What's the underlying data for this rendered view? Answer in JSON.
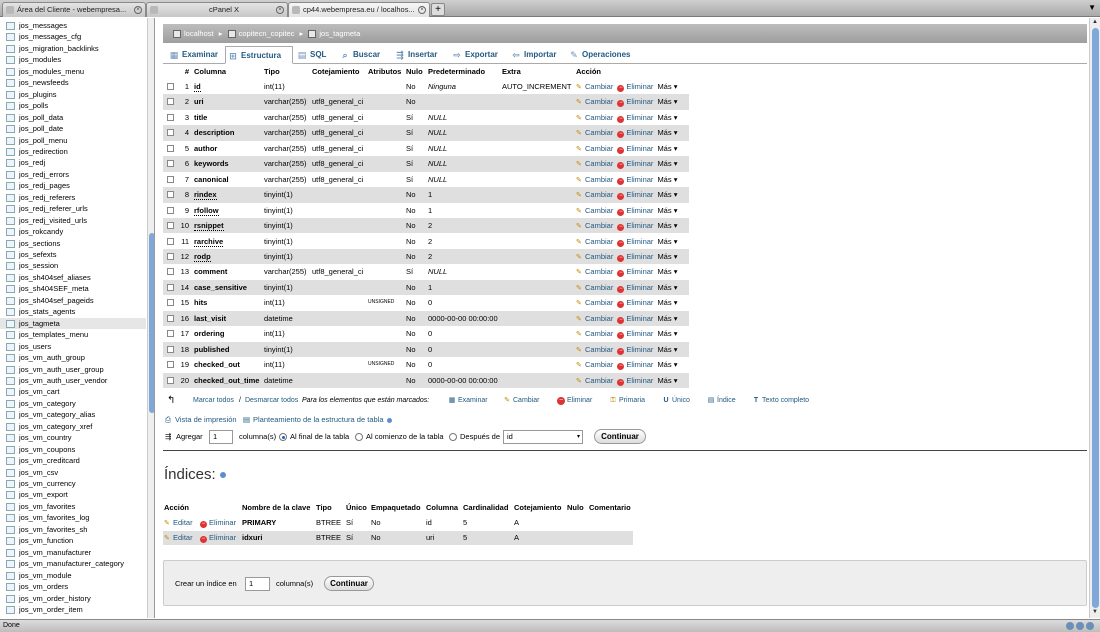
{
  "browser": {
    "tabs": [
      {
        "label": "Área del Cliente - webempresa...",
        "active": false
      },
      {
        "label": "cPanel X",
        "active": false
      },
      {
        "label": "cp44.webempresa.eu / localhos...",
        "active": true
      }
    ],
    "new_tab": "+",
    "status": "Done"
  },
  "left_tables": [
    "jos_messages",
    "jos_messages_cfg",
    "jos_migration_backlinks",
    "jos_modules",
    "jos_modules_menu",
    "jos_newsfeeds",
    "jos_plugins",
    "jos_polls",
    "jos_poll_data",
    "jos_poll_date",
    "jos_poll_menu",
    "jos_redirection",
    "jos_redj",
    "jos_redj_errors",
    "jos_redj_pages",
    "jos_redj_referers",
    "jos_redj_referer_urls",
    "jos_redj_visited_urls",
    "jos_rokcandy",
    "jos_sections",
    "jos_sefexts",
    "jos_session",
    "jos_sh404sef_aliases",
    "jos_sh404SEF_meta",
    "jos_sh404sef_pageids",
    "jos_stats_agents",
    "jos_tagmeta",
    "jos_templates_menu",
    "jos_users",
    "jos_vm_auth_group",
    "jos_vm_auth_user_group",
    "jos_vm_auth_user_vendor",
    "jos_vm_cart",
    "jos_vm_category",
    "jos_vm_category_alias",
    "jos_vm_category_xref",
    "jos_vm_country",
    "jos_vm_coupons",
    "jos_vm_creditcard",
    "jos_vm_csv",
    "jos_vm_currency",
    "jos_vm_export",
    "jos_vm_favorites",
    "jos_vm_favorites_log",
    "jos_vm_favorites_sh",
    "jos_vm_function",
    "jos_vm_manufacturer",
    "jos_vm_manufacturer_category",
    "jos_vm_module",
    "jos_vm_orders",
    "jos_vm_order_history",
    "jos_vm_order_item"
  ],
  "current_table_index": 26,
  "breadcrumb": {
    "server": "localhost",
    "database": "copitecn_copitec",
    "table": "jos_tagmeta",
    "sep": "▸"
  },
  "tabs": [
    {
      "label": "Examinar",
      "icon": "▦"
    },
    {
      "label": "Estructura",
      "icon": "⊞",
      "active": true
    },
    {
      "label": "SQL",
      "icon": "▤"
    },
    {
      "label": "Buscar",
      "icon": "⌕"
    },
    {
      "label": "Insertar",
      "icon": "⇶"
    },
    {
      "label": "Exportar",
      "icon": "⇨"
    },
    {
      "label": "Importar",
      "icon": "⇦"
    },
    {
      "label": "Operaciones",
      "icon": "✎"
    }
  ],
  "structure": {
    "headers": {
      "num": "#",
      "col": "Columna",
      "typ": "Tipo",
      "cot": "Cotejamiento",
      "atr": "Atributos",
      "nul": "Nulo",
      "pre": "Predeterminado",
      "ext": "Extra",
      "act": "Acción"
    },
    "actions": {
      "change": "Cambiar",
      "delete": "Eliminar",
      "more": "Más ▾"
    },
    "rows": [
      {
        "num": "1",
        "col": "id",
        "typ": "int(11)",
        "cot": "",
        "atr": "",
        "nul": "No",
        "pre": "Ninguna",
        "ext": "AUTO_INCREMENT",
        "pre_italic": true,
        "dotted": true
      },
      {
        "num": "2",
        "col": "uri",
        "typ": "varchar(255)",
        "cot": "utf8_general_ci",
        "atr": "",
        "nul": "No",
        "pre": "",
        "ext": ""
      },
      {
        "num": "3",
        "col": "title",
        "typ": "varchar(255)",
        "cot": "utf8_general_ci",
        "atr": "",
        "nul": "Sí",
        "pre": "NULL",
        "ext": "",
        "pre_italic": true
      },
      {
        "num": "4",
        "col": "description",
        "typ": "varchar(255)",
        "cot": "utf8_general_ci",
        "atr": "",
        "nul": "Sí",
        "pre": "NULL",
        "ext": "",
        "pre_italic": true
      },
      {
        "num": "5",
        "col": "author",
        "typ": "varchar(255)",
        "cot": "utf8_general_ci",
        "atr": "",
        "nul": "Sí",
        "pre": "NULL",
        "ext": "",
        "pre_italic": true
      },
      {
        "num": "6",
        "col": "keywords",
        "typ": "varchar(255)",
        "cot": "utf8_general_ci",
        "atr": "",
        "nul": "Sí",
        "pre": "NULL",
        "ext": "",
        "pre_italic": true
      },
      {
        "num": "7",
        "col": "canonical",
        "typ": "varchar(255)",
        "cot": "utf8_general_ci",
        "atr": "",
        "nul": "Sí",
        "pre": "NULL",
        "ext": "",
        "pre_italic": true
      },
      {
        "num": "8",
        "col": "rindex",
        "typ": "tinyint(1)",
        "cot": "",
        "atr": "",
        "nul": "No",
        "pre": "1",
        "ext": "",
        "dotted": true
      },
      {
        "num": "9",
        "col": "rfollow",
        "typ": "tinyint(1)",
        "cot": "",
        "atr": "",
        "nul": "No",
        "pre": "1",
        "ext": "",
        "dotted": true
      },
      {
        "num": "10",
        "col": "rsnippet",
        "typ": "tinyint(1)",
        "cot": "",
        "atr": "",
        "nul": "No",
        "pre": "2",
        "ext": "",
        "dotted": true
      },
      {
        "num": "11",
        "col": "rarchive",
        "typ": "tinyint(1)",
        "cot": "",
        "atr": "",
        "nul": "No",
        "pre": "2",
        "ext": "",
        "dotted": true
      },
      {
        "num": "12",
        "col": "rodp",
        "typ": "tinyint(1)",
        "cot": "",
        "atr": "",
        "nul": "No",
        "pre": "2",
        "ext": "",
        "dotted": true
      },
      {
        "num": "13",
        "col": "comment",
        "typ": "varchar(255)",
        "cot": "utf8_general_ci",
        "atr": "",
        "nul": "Sí",
        "pre": "NULL",
        "ext": "",
        "pre_italic": true
      },
      {
        "num": "14",
        "col": "case_sensitive",
        "typ": "tinyint(1)",
        "cot": "",
        "atr": "",
        "nul": "No",
        "pre": "1",
        "ext": ""
      },
      {
        "num": "15",
        "col": "hits",
        "typ": "int(11)",
        "cot": "",
        "atr": "UNSIGNED",
        "nul": "No",
        "pre": "0",
        "ext": ""
      },
      {
        "num": "16",
        "col": "last_visit",
        "typ": "datetime",
        "cot": "",
        "atr": "",
        "nul": "No",
        "pre": "0000-00-00 00:00:00",
        "ext": ""
      },
      {
        "num": "17",
        "col": "ordering",
        "typ": "int(11)",
        "cot": "",
        "atr": "",
        "nul": "No",
        "pre": "0",
        "ext": ""
      },
      {
        "num": "18",
        "col": "published",
        "typ": "tinyint(1)",
        "cot": "",
        "atr": "",
        "nul": "No",
        "pre": "0",
        "ext": ""
      },
      {
        "num": "19",
        "col": "checked_out",
        "typ": "int(11)",
        "cot": "",
        "atr": "UNSIGNED",
        "nul": "No",
        "pre": "0",
        "ext": ""
      },
      {
        "num": "20",
        "col": "checked_out_time",
        "typ": "datetime",
        "cot": "",
        "atr": "",
        "nul": "No",
        "pre": "0000-00-00 00:00:00",
        "ext": ""
      }
    ]
  },
  "check_all": {
    "mark": "Marcar todos",
    "sep": "/",
    "unmark": "Desmarcar todos",
    "for_selected": "Para los elementos que están marcados:",
    "actions": [
      {
        "label": "Examinar",
        "icon": "▦"
      },
      {
        "label": "Cambiar",
        "icon": "✎"
      },
      {
        "label": "Eliminar",
        "icon": "−"
      },
      {
        "label": "Primaria",
        "icon": "⚿"
      },
      {
        "label": "Único",
        "icon": "U"
      },
      {
        "label": "Índice",
        "icon": "▤"
      },
      {
        "label": "Texto completo",
        "icon": "T"
      }
    ]
  },
  "print": {
    "view": "Vista de impresión",
    "plan": "Planteamiento de la estructura de tabla"
  },
  "add": {
    "label": "Agregar",
    "count": "1",
    "columns": "columna(s)",
    "opt_end": "Al final de la tabla",
    "opt_start": "Al comienzo de la tabla",
    "opt_after": "Después de",
    "after_value": "id",
    "button": "Continuar"
  },
  "indices": {
    "title": "Índices:",
    "headers": {
      "acc": "Acción",
      "key": "Nombre de la clave",
      "tip": "Tipo",
      "uni": "Único",
      "emp": "Empaquetado",
      "col": "Columna",
      "car": "Cardinalidad",
      "cot": "Cotejamiento",
      "nul": "Nulo",
      "com": "Comentario"
    },
    "edit": "Editar",
    "delete": "Eliminar",
    "rows": [
      {
        "key": "PRIMARY",
        "tip": "BTREE",
        "uni": "Sí",
        "emp": "No",
        "col": "id",
        "car": "5",
        "cot": "A",
        "nul": "",
        "com": ""
      },
      {
        "key": "idxuri",
        "tip": "BTREE",
        "uni": "Sí",
        "emp": "No",
        "col": "uri",
        "car": "5",
        "cot": "A",
        "nul": "",
        "com": ""
      }
    ]
  },
  "create_index": {
    "label": "Crear un índice en",
    "count": "1",
    "columns": "columna(s)",
    "button": "Continuar"
  }
}
